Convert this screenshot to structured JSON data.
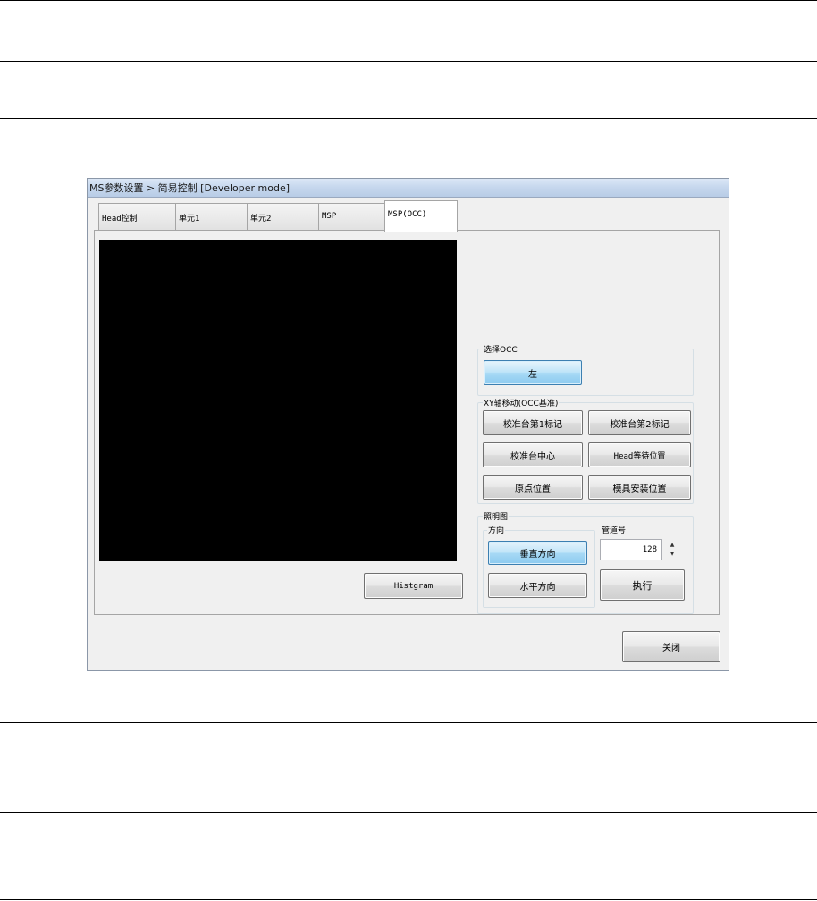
{
  "window": {
    "title": "MS参数设置 > 简易控制 [Developer mode]"
  },
  "tabs": [
    {
      "label": "Head控制"
    },
    {
      "label": "单元1"
    },
    {
      "label": "单元2"
    },
    {
      "label": "MSP"
    },
    {
      "label": "MSP(OCC)",
      "active": true
    }
  ],
  "buttons": {
    "histgram": "Histgram",
    "close": "关闭",
    "execute": "执行"
  },
  "select_occ": {
    "label": "选择OCC",
    "left_button": "左"
  },
  "xy_move": {
    "label": "XY轴移动(OCC基准)",
    "buttons": [
      "校准台第1标记",
      "校准台第2标记",
      "校准台中心",
      "Head等待位置",
      "原点位置",
      "模具安装位置"
    ]
  },
  "lighting": {
    "label": "照明图",
    "direction": {
      "label": "方向",
      "vertical": "垂直方向",
      "horizontal": "水平方向"
    },
    "channel": {
      "label": "管道号",
      "value": "128",
      "up_arrow": "▲",
      "down_arrow": "▼"
    }
  }
}
